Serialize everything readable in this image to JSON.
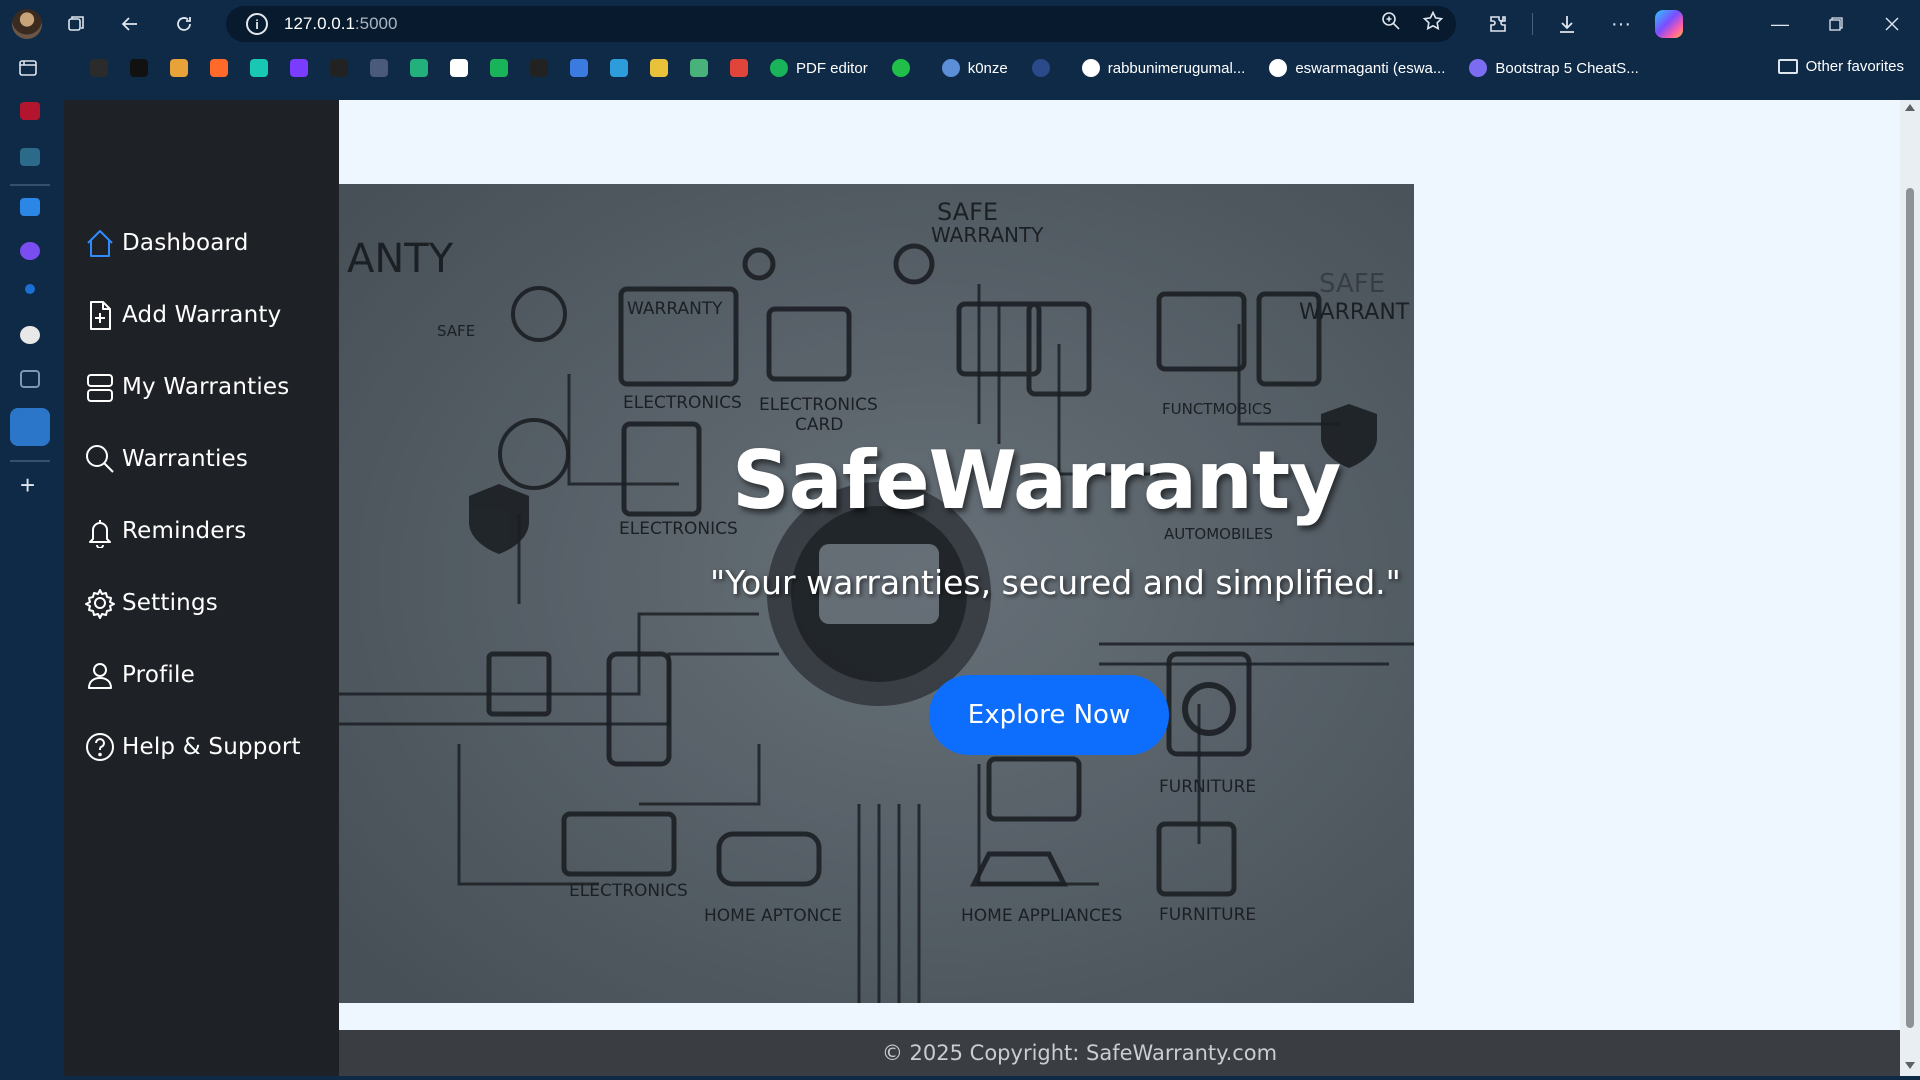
{
  "browser": {
    "url_host": "127.0.0.1",
    "url_port": ":5000",
    "bookmarks": [
      {
        "label": "",
        "color": "#2b2b2b"
      },
      {
        "label": "",
        "color": "#111111"
      },
      {
        "label": "",
        "color": "#e8a23a"
      },
      {
        "label": "",
        "color": "#ff6a2b"
      },
      {
        "label": "",
        "color": "#19c7b5"
      },
      {
        "label": "",
        "color": "#7a3cff"
      },
      {
        "label": "",
        "color": "#222222"
      },
      {
        "label": "",
        "color": "#4a5a7a"
      },
      {
        "label": "",
        "color": "#22b07d"
      },
      {
        "label": "",
        "color": "#ffffff"
      },
      {
        "label": "",
        "color": "#19b35a"
      },
      {
        "label": "",
        "color": "#222222"
      },
      {
        "label": "",
        "color": "#3b7be0"
      },
      {
        "label": "",
        "color": "#2d9cdb"
      },
      {
        "label": "",
        "color": "#e8c23a"
      },
      {
        "label": "",
        "color": "#49b27a"
      },
      {
        "label": "",
        "color": "#e0443a"
      }
    ],
    "named_bookmarks": [
      {
        "label": "PDF editor",
        "color": "#19b35a"
      },
      {
        "label": "",
        "color": "#1fbf4a"
      },
      {
        "label": "k0nze",
        "color": "#5d8fd8"
      },
      {
        "label": "",
        "color": "#2a4a8a"
      },
      {
        "label": "rabbunimerugumal...",
        "color": "#ffffff"
      },
      {
        "label": "eswarmaganti (eswa...",
        "color": "#ffffff"
      },
      {
        "label": "Bootstrap 5 CheatS...",
        "color": "#7c6cf2"
      }
    ],
    "other_favorites": "Other favorites"
  },
  "sidebar": {
    "items": [
      {
        "label": "Dashboard",
        "icon": "home-icon"
      },
      {
        "label": "Add Warranty",
        "icon": "file-plus-icon"
      },
      {
        "label": "My Warranties",
        "icon": "stack-icon"
      },
      {
        "label": "Warranties",
        "icon": "search-icon"
      },
      {
        "label": "Reminders",
        "icon": "bell-icon"
      },
      {
        "label": "Settings",
        "icon": "gear-icon"
      },
      {
        "label": "Profile",
        "icon": "person-icon"
      },
      {
        "label": "Help & Support",
        "icon": "question-circle-icon"
      }
    ]
  },
  "hero": {
    "title": "SafeWarranty",
    "tagline": "\"Your warranties, secured and simplified.\"",
    "button": "Explore Now",
    "art_labels": {
      "safe_warranty_top": "SAFE",
      "safe_warranty_top2": "WARRANTY",
      "warranty_card": "WARRANTY",
      "electronics": "ELECTRONICS",
      "electronics_card": "ELECTRONICS",
      "card": "CARD",
      "electronics2": "ELECTRONICS",
      "electronics3": "ELECTRONICS",
      "home_apptonce": "HOME APTONCE",
      "home_appliances": "HOME APPLIANCES",
      "furniture": "FURNITURE",
      "furniture2": "FURNITURE",
      "automobiles": "AUTOMOBILES",
      "functmobics": "FUNCTMOBICS",
      "safe": "SAFE",
      "anty": "ANTY",
      "safe_right": "SAFE",
      "warrant_right": "WARRANT"
    }
  },
  "footer": {
    "copyright": "© 2025 Copyright: SafeWarranty.com"
  }
}
